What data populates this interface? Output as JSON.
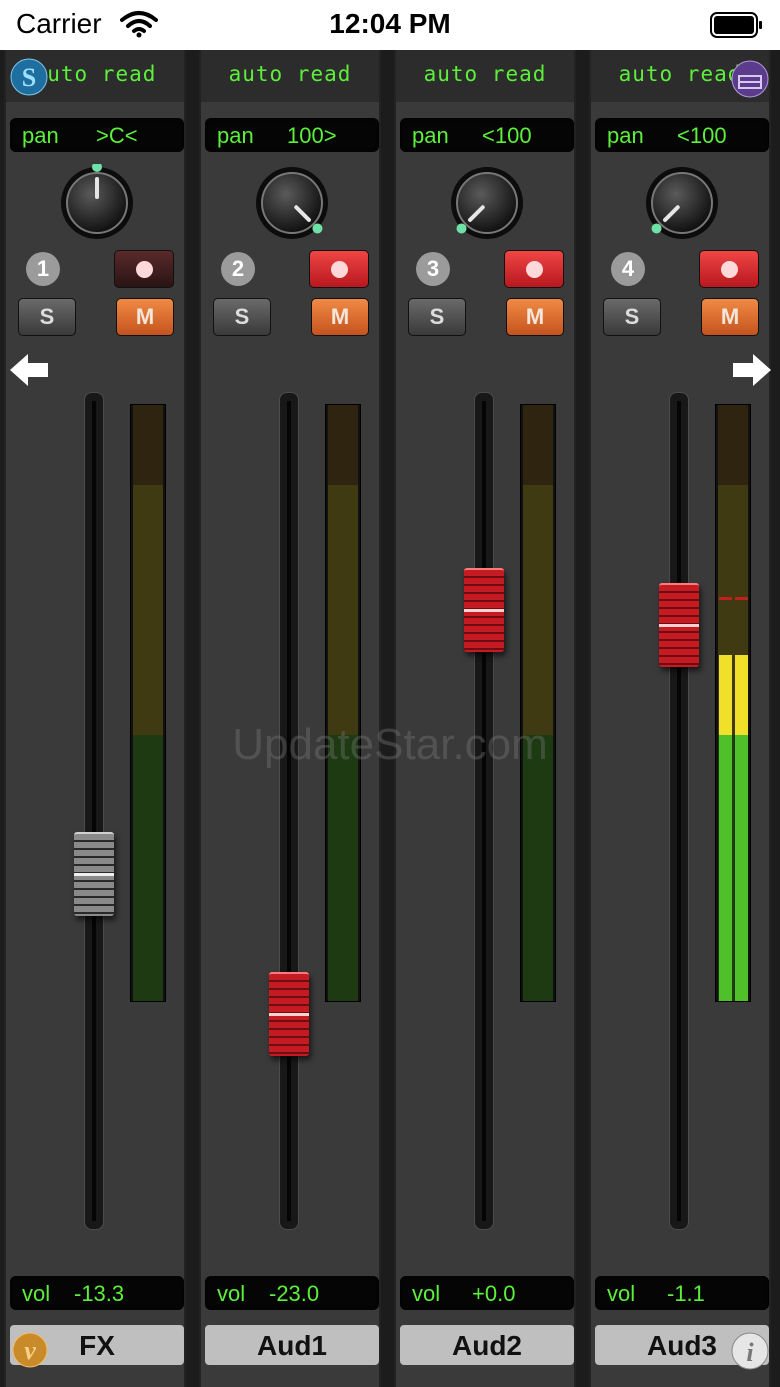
{
  "status_bar": {
    "carrier": "Carrier",
    "time": "12:04 PM"
  },
  "watermark": "UpdateStar.com",
  "colors": {
    "lcd_text": "#5cf03a",
    "record_on": "#d9242a",
    "record_off": "#4a2020",
    "mute": "#e0692a"
  },
  "channels": [
    {
      "auto": "auto read",
      "pan_label": "pan",
      "pan_value": ">C<",
      "pan_position": 0.0,
      "number": "1",
      "record_armed": false,
      "solo_label": "S",
      "mute_label": "M",
      "vol_label": "vol",
      "vol_value": "-13.3",
      "fader_level": 0.42,
      "fader_color": "gray",
      "meter_level": 0.0,
      "name": "FX"
    },
    {
      "auto": "auto read",
      "pan_label": "pan",
      "pan_value": "100>",
      "pan_position": 1.0,
      "number": "2",
      "record_armed": true,
      "solo_label": "S",
      "mute_label": "M",
      "vol_label": "vol",
      "vol_value": "-23.0",
      "fader_level": 0.24,
      "fader_color": "red",
      "meter_level": 0.0,
      "name": "Aud1"
    },
    {
      "auto": "auto read",
      "pan_label": "pan",
      "pan_value": "<100",
      "pan_position": -1.0,
      "number": "3",
      "record_armed": true,
      "solo_label": "S",
      "mute_label": "M",
      "vol_label": "vol",
      "vol_value": "+0.0",
      "fader_level": 0.76,
      "fader_color": "red",
      "meter_level": 0.0,
      "name": "Aud2"
    },
    {
      "auto": "auto read",
      "pan_label": "pan",
      "pan_value": "<100",
      "pan_position": -1.0,
      "number": "4",
      "record_armed": true,
      "solo_label": "S",
      "mute_label": "M",
      "vol_label": "vol",
      "vol_value": "-1.1",
      "fader_level": 0.74,
      "fader_color": "red",
      "meter_level": 0.58,
      "name": "Aud3"
    }
  ]
}
